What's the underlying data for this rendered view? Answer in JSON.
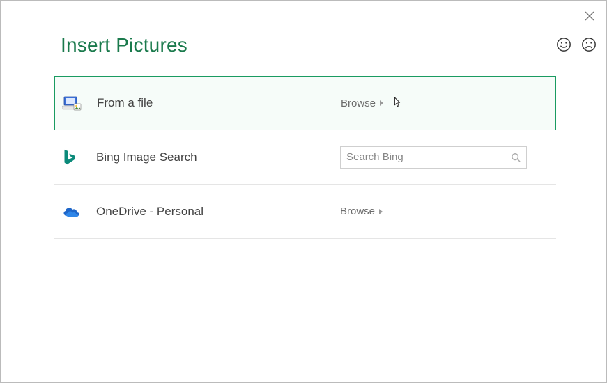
{
  "dialog": {
    "title": "Insert Pictures"
  },
  "options": {
    "file": {
      "label": "From a file",
      "action": "Browse"
    },
    "bing": {
      "label": "Bing Image Search",
      "placeholder": "Search Bing"
    },
    "onedrive": {
      "label": "OneDrive - Personal",
      "action": "Browse"
    }
  }
}
